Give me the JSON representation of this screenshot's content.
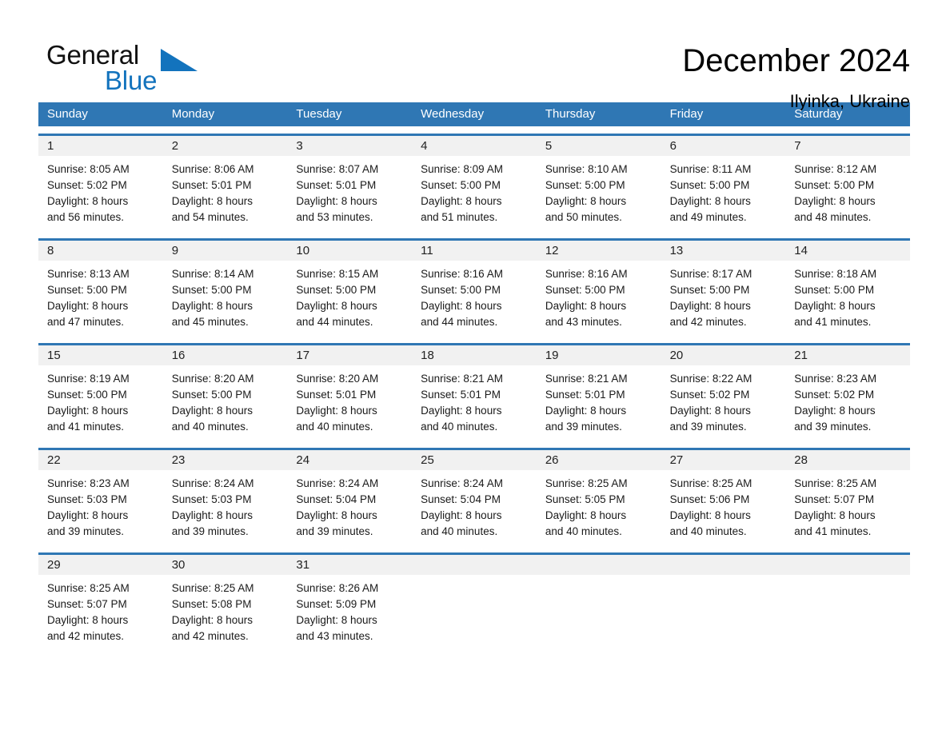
{
  "brand": {
    "name_part1": "General",
    "name_part2": "Blue",
    "accent_color": "#1373bd",
    "header_color": "#2f77b4"
  },
  "header": {
    "title": "December 2024",
    "subtitle": "Ilyinka, Ukraine"
  },
  "weekday_headers": [
    "Sunday",
    "Monday",
    "Tuesday",
    "Wednesday",
    "Thursday",
    "Friday",
    "Saturday"
  ],
  "weeks": [
    [
      {
        "day": "1",
        "sunrise": "Sunrise: 8:05 AM",
        "sunset": "Sunset: 5:02 PM",
        "daylight1": "Daylight: 8 hours",
        "daylight2": "and 56 minutes."
      },
      {
        "day": "2",
        "sunrise": "Sunrise: 8:06 AM",
        "sunset": "Sunset: 5:01 PM",
        "daylight1": "Daylight: 8 hours",
        "daylight2": "and 54 minutes."
      },
      {
        "day": "3",
        "sunrise": "Sunrise: 8:07 AM",
        "sunset": "Sunset: 5:01 PM",
        "daylight1": "Daylight: 8 hours",
        "daylight2": "and 53 minutes."
      },
      {
        "day": "4",
        "sunrise": "Sunrise: 8:09 AM",
        "sunset": "Sunset: 5:00 PM",
        "daylight1": "Daylight: 8 hours",
        "daylight2": "and 51 minutes."
      },
      {
        "day": "5",
        "sunrise": "Sunrise: 8:10 AM",
        "sunset": "Sunset: 5:00 PM",
        "daylight1": "Daylight: 8 hours",
        "daylight2": "and 50 minutes."
      },
      {
        "day": "6",
        "sunrise": "Sunrise: 8:11 AM",
        "sunset": "Sunset: 5:00 PM",
        "daylight1": "Daylight: 8 hours",
        "daylight2": "and 49 minutes."
      },
      {
        "day": "7",
        "sunrise": "Sunrise: 8:12 AM",
        "sunset": "Sunset: 5:00 PM",
        "daylight1": "Daylight: 8 hours",
        "daylight2": "and 48 minutes."
      }
    ],
    [
      {
        "day": "8",
        "sunrise": "Sunrise: 8:13 AM",
        "sunset": "Sunset: 5:00 PM",
        "daylight1": "Daylight: 8 hours",
        "daylight2": "and 47 minutes."
      },
      {
        "day": "9",
        "sunrise": "Sunrise: 8:14 AM",
        "sunset": "Sunset: 5:00 PM",
        "daylight1": "Daylight: 8 hours",
        "daylight2": "and 45 minutes."
      },
      {
        "day": "10",
        "sunrise": "Sunrise: 8:15 AM",
        "sunset": "Sunset: 5:00 PM",
        "daylight1": "Daylight: 8 hours",
        "daylight2": "and 44 minutes."
      },
      {
        "day": "11",
        "sunrise": "Sunrise: 8:16 AM",
        "sunset": "Sunset: 5:00 PM",
        "daylight1": "Daylight: 8 hours",
        "daylight2": "and 44 minutes."
      },
      {
        "day": "12",
        "sunrise": "Sunrise: 8:16 AM",
        "sunset": "Sunset: 5:00 PM",
        "daylight1": "Daylight: 8 hours",
        "daylight2": "and 43 minutes."
      },
      {
        "day": "13",
        "sunrise": "Sunrise: 8:17 AM",
        "sunset": "Sunset: 5:00 PM",
        "daylight1": "Daylight: 8 hours",
        "daylight2": "and 42 minutes."
      },
      {
        "day": "14",
        "sunrise": "Sunrise: 8:18 AM",
        "sunset": "Sunset: 5:00 PM",
        "daylight1": "Daylight: 8 hours",
        "daylight2": "and 41 minutes."
      }
    ],
    [
      {
        "day": "15",
        "sunrise": "Sunrise: 8:19 AM",
        "sunset": "Sunset: 5:00 PM",
        "daylight1": "Daylight: 8 hours",
        "daylight2": "and 41 minutes."
      },
      {
        "day": "16",
        "sunrise": "Sunrise: 8:20 AM",
        "sunset": "Sunset: 5:00 PM",
        "daylight1": "Daylight: 8 hours",
        "daylight2": "and 40 minutes."
      },
      {
        "day": "17",
        "sunrise": "Sunrise: 8:20 AM",
        "sunset": "Sunset: 5:01 PM",
        "daylight1": "Daylight: 8 hours",
        "daylight2": "and 40 minutes."
      },
      {
        "day": "18",
        "sunrise": "Sunrise: 8:21 AM",
        "sunset": "Sunset: 5:01 PM",
        "daylight1": "Daylight: 8 hours",
        "daylight2": "and 40 minutes."
      },
      {
        "day": "19",
        "sunrise": "Sunrise: 8:21 AM",
        "sunset": "Sunset: 5:01 PM",
        "daylight1": "Daylight: 8 hours",
        "daylight2": "and 39 minutes."
      },
      {
        "day": "20",
        "sunrise": "Sunrise: 8:22 AM",
        "sunset": "Sunset: 5:02 PM",
        "daylight1": "Daylight: 8 hours",
        "daylight2": "and 39 minutes."
      },
      {
        "day": "21",
        "sunrise": "Sunrise: 8:23 AM",
        "sunset": "Sunset: 5:02 PM",
        "daylight1": "Daylight: 8 hours",
        "daylight2": "and 39 minutes."
      }
    ],
    [
      {
        "day": "22",
        "sunrise": "Sunrise: 8:23 AM",
        "sunset": "Sunset: 5:03 PM",
        "daylight1": "Daylight: 8 hours",
        "daylight2": "and 39 minutes."
      },
      {
        "day": "23",
        "sunrise": "Sunrise: 8:24 AM",
        "sunset": "Sunset: 5:03 PM",
        "daylight1": "Daylight: 8 hours",
        "daylight2": "and 39 minutes."
      },
      {
        "day": "24",
        "sunrise": "Sunrise: 8:24 AM",
        "sunset": "Sunset: 5:04 PM",
        "daylight1": "Daylight: 8 hours",
        "daylight2": "and 39 minutes."
      },
      {
        "day": "25",
        "sunrise": "Sunrise: 8:24 AM",
        "sunset": "Sunset: 5:04 PM",
        "daylight1": "Daylight: 8 hours",
        "daylight2": "and 40 minutes."
      },
      {
        "day": "26",
        "sunrise": "Sunrise: 8:25 AM",
        "sunset": "Sunset: 5:05 PM",
        "daylight1": "Daylight: 8 hours",
        "daylight2": "and 40 minutes."
      },
      {
        "day": "27",
        "sunrise": "Sunrise: 8:25 AM",
        "sunset": "Sunset: 5:06 PM",
        "daylight1": "Daylight: 8 hours",
        "daylight2": "and 40 minutes."
      },
      {
        "day": "28",
        "sunrise": "Sunrise: 8:25 AM",
        "sunset": "Sunset: 5:07 PM",
        "daylight1": "Daylight: 8 hours",
        "daylight2": "and 41 minutes."
      }
    ],
    [
      {
        "day": "29",
        "sunrise": "Sunrise: 8:25 AM",
        "sunset": "Sunset: 5:07 PM",
        "daylight1": "Daylight: 8 hours",
        "daylight2": "and 42 minutes."
      },
      {
        "day": "30",
        "sunrise": "Sunrise: 8:25 AM",
        "sunset": "Sunset: 5:08 PM",
        "daylight1": "Daylight: 8 hours",
        "daylight2": "and 42 minutes."
      },
      {
        "day": "31",
        "sunrise": "Sunrise: 8:26 AM",
        "sunset": "Sunset: 5:09 PM",
        "daylight1": "Daylight: 8 hours",
        "daylight2": "and 43 minutes."
      },
      {
        "day": "",
        "sunrise": "",
        "sunset": "",
        "daylight1": "",
        "daylight2": ""
      },
      {
        "day": "",
        "sunrise": "",
        "sunset": "",
        "daylight1": "",
        "daylight2": ""
      },
      {
        "day": "",
        "sunrise": "",
        "sunset": "",
        "daylight1": "",
        "daylight2": ""
      },
      {
        "day": "",
        "sunrise": "",
        "sunset": "",
        "daylight1": "",
        "daylight2": ""
      }
    ]
  ]
}
